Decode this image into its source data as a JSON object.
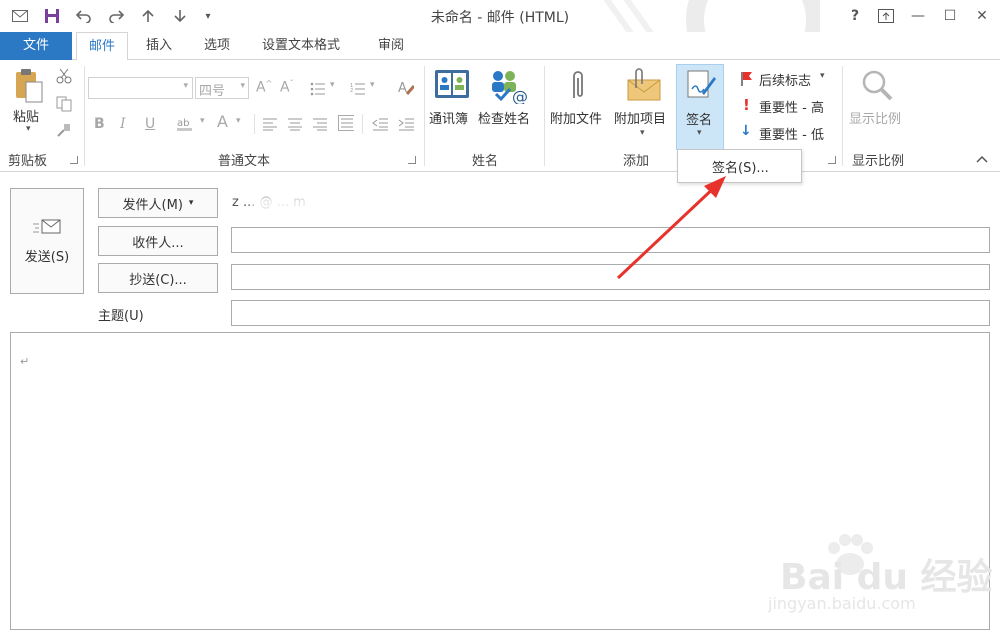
{
  "window": {
    "title": "未命名 - 邮件 (HTML)",
    "help": "?",
    "restore_ribbon": "⇱",
    "minimize": "—",
    "maximize": "☐",
    "close": "✕"
  },
  "quick_access": {
    "mail_icon": "envelope-icon",
    "save_icon": "save-icon",
    "undo_icon": "undo-icon",
    "redo_icon": "redo-icon",
    "up_icon": "up-arrow-icon",
    "down_icon": "down-arrow-icon",
    "customize_icon": "dropdown-icon"
  },
  "tabs": [
    {
      "label": "文件"
    },
    {
      "label": "邮件"
    },
    {
      "label": "插入"
    },
    {
      "label": "选项"
    },
    {
      "label": "设置文本格式"
    },
    {
      "label": "审阅"
    }
  ],
  "ribbon": {
    "clipboard": {
      "paste_label": "粘贴",
      "group_label": "剪贴板"
    },
    "basic_text": {
      "font_size": "四号",
      "bold": "B",
      "italic": "I",
      "underline": "U",
      "group_label": "普通文本"
    },
    "names": {
      "address_book": "通讯簿",
      "check_names": "检查姓名",
      "group_label": "姓名"
    },
    "include": {
      "attach_file": "附加文件",
      "attach_item": "附加项目",
      "signature": "签名",
      "group_label": "添加"
    },
    "tags": {
      "follow_up": "后续标志",
      "high_importance": "重要性 - 高",
      "low_importance": "重要性 - 低"
    },
    "zoom": {
      "zoom_label": "显示比例",
      "group_label": "显示比例"
    }
  },
  "signature_menu": {
    "item": "签名(S)..."
  },
  "compose": {
    "send_label": "发送(S)",
    "from_label": "发件人(M)",
    "from_value": "z  ...  @ ... m",
    "to_label": "收件人...",
    "cc_label": "抄送(C)...",
    "subject_label": "主题(U)",
    "body_mark": "↵"
  },
  "colors": {
    "accent": "#2b78c5",
    "arrow": "#e8322c",
    "selected_bg": "#cde6f7"
  },
  "watermark": {
    "text": "Bai du 经验",
    "url": "jingyan.baidu.com"
  }
}
